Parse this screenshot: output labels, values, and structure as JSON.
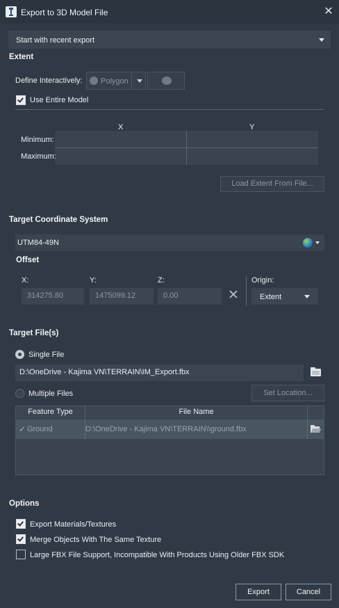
{
  "window": {
    "title": "Export to 3D Model File",
    "close_icon": "close-icon"
  },
  "recent_export": {
    "value": "Start with recent export"
  },
  "extent": {
    "section_title": "Extent",
    "define_label": "Define Interactively:",
    "polygon_label": "Polygon",
    "use_entire_model_label": "Use Entire Model",
    "use_entire_model_checked": true,
    "x_label": "X",
    "y_label": "Y",
    "minimum_label": "Minimum:",
    "maximum_label": "Maximum:",
    "load_button": "Load Extent From File..."
  },
  "target_coord": {
    "section_title": "Target Coordinate System",
    "value": "UTM84-49N",
    "offset_title": "Offset",
    "x_label": "X:",
    "y_label": "Y:",
    "z_label": "Z:",
    "x_value": "314275.80",
    "y_value": "1475099.12",
    "z_value": "0.00",
    "origin_label": "Origin:",
    "origin_value": "Extent"
  },
  "target_files": {
    "section_title": "Target File(s)",
    "single_file_label": "Single File",
    "single_file_path": "D:\\OneDrive - Kajima VN\\TERRAIN\\IM_Export.fbx",
    "multiple_files_label": "Multiple Files",
    "set_location_button": "Set Location...",
    "table_headers": [
      "Feature Type",
      "File Name"
    ],
    "rows": [
      {
        "feature_type": "Ground",
        "file_name": "D:\\OneDrive - Kajima VN\\TERRAIN\\\\ground.fbx",
        "checked": true
      }
    ]
  },
  "options": {
    "section_title": "Options",
    "items": [
      {
        "label": "Export Materials/Textures",
        "checked": true
      },
      {
        "label": "Merge Objects With The Same Texture",
        "checked": true
      },
      {
        "label": "Large FBX File Support, Incompatible With Products Using Older FBX SDK",
        "checked": false
      }
    ]
  },
  "footer": {
    "export_button": "Export",
    "cancel_button": "Cancel"
  }
}
